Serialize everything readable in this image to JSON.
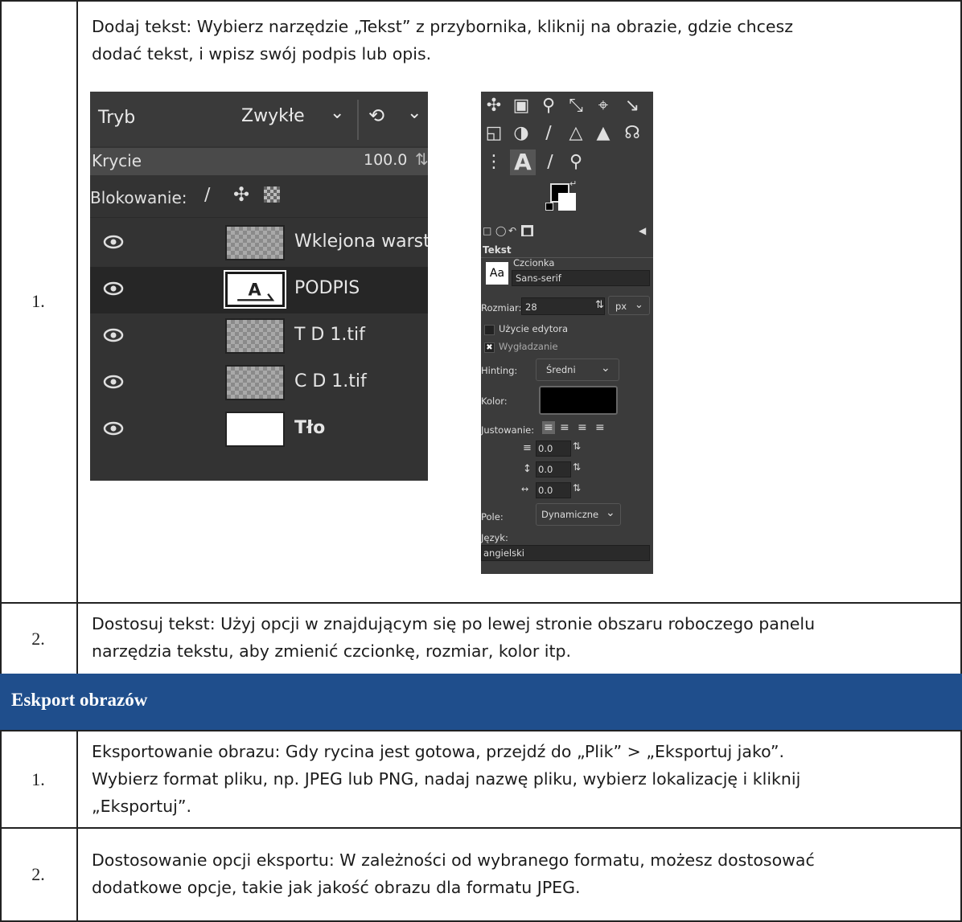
{
  "rows": [
    {
      "number": "1.",
      "text_line1": "Dodaj tekst: Wybierz narzędzie „Tekst” z przybornika, kliknij na obrazie, gdzie chcesz",
      "text_line2": "dodać tekst, i wpisz swój podpis lub opis."
    },
    {
      "number": "2.",
      "text_line1": "Dostosuj tekst: Użyj opcji w znajdującym się po lewej stronie obszaru roboczego panelu",
      "text_line2": "narzędzia tekstu, aby zmienić czcionkę, rozmiar, kolor itp."
    }
  ],
  "section": {
    "title": "Eskport obrazów",
    "color": "#1f4e8c"
  },
  "export_rows": [
    {
      "number": "1.",
      "text_line1": "Eksportowanie obrazu: Gdy rycina jest gotowa, przejdź do „Plik” > „Eksportuj jako”.",
      "text_line2": "Wybierz format pliku, np. JPEG lub PNG, nadaj nazwę pliku, wybierz lokalizację i kliknij",
      "text_line3": "„Eksportuj”."
    },
    {
      "number": "2.",
      "text_line1": "Dostosowanie opcji eksportu: W zależności od wybranego formatu, możesz dostosować",
      "text_line2": "dodatkowe opcje, takie jak jakość obrazu dla formatu JPEG."
    }
  ],
  "layers_panel": {
    "mode_label": "Tryb",
    "mode_value": "Zwykłe",
    "opacity_label": "Krycie",
    "opacity_value": "100.0",
    "lock_label": "Blokowanie:",
    "layers": [
      {
        "name": "Wklejona warst",
        "thumb": "checker",
        "selected": false,
        "bold": false
      },
      {
        "name": "PODPIS",
        "thumb": "text",
        "selected": true,
        "bold": false
      },
      {
        "name": "T D 1.tif",
        "thumb": "checker",
        "selected": false,
        "bold": false
      },
      {
        "name": "C D 1.tif",
        "thumb": "checker",
        "selected": false,
        "bold": false
      },
      {
        "name": "Tło",
        "thumb": "white",
        "selected": false,
        "bold": true
      }
    ]
  },
  "text_tool": {
    "title": "Tekst",
    "font_label": "Czcionka",
    "font_value": "Sans-serif",
    "font_preview": "Aa",
    "size_label": "Rozmiar:",
    "size_value": "28",
    "size_unit": "px",
    "use_editor": "Użycie edytora",
    "antialias": "Wygładzanie",
    "hinting_label": "Hinting:",
    "hinting_value": "Średni",
    "color_label": "Kolor:",
    "justify_label": "Justowanie:",
    "indent_value": "0.0",
    "line_spacing_value": "0.0",
    "letter_spacing_value": "0.0",
    "box_label": "Pole:",
    "box_value": "Dynamiczne",
    "language_label": "Język:",
    "language_value": "angielski",
    "text_color": "#000000"
  }
}
